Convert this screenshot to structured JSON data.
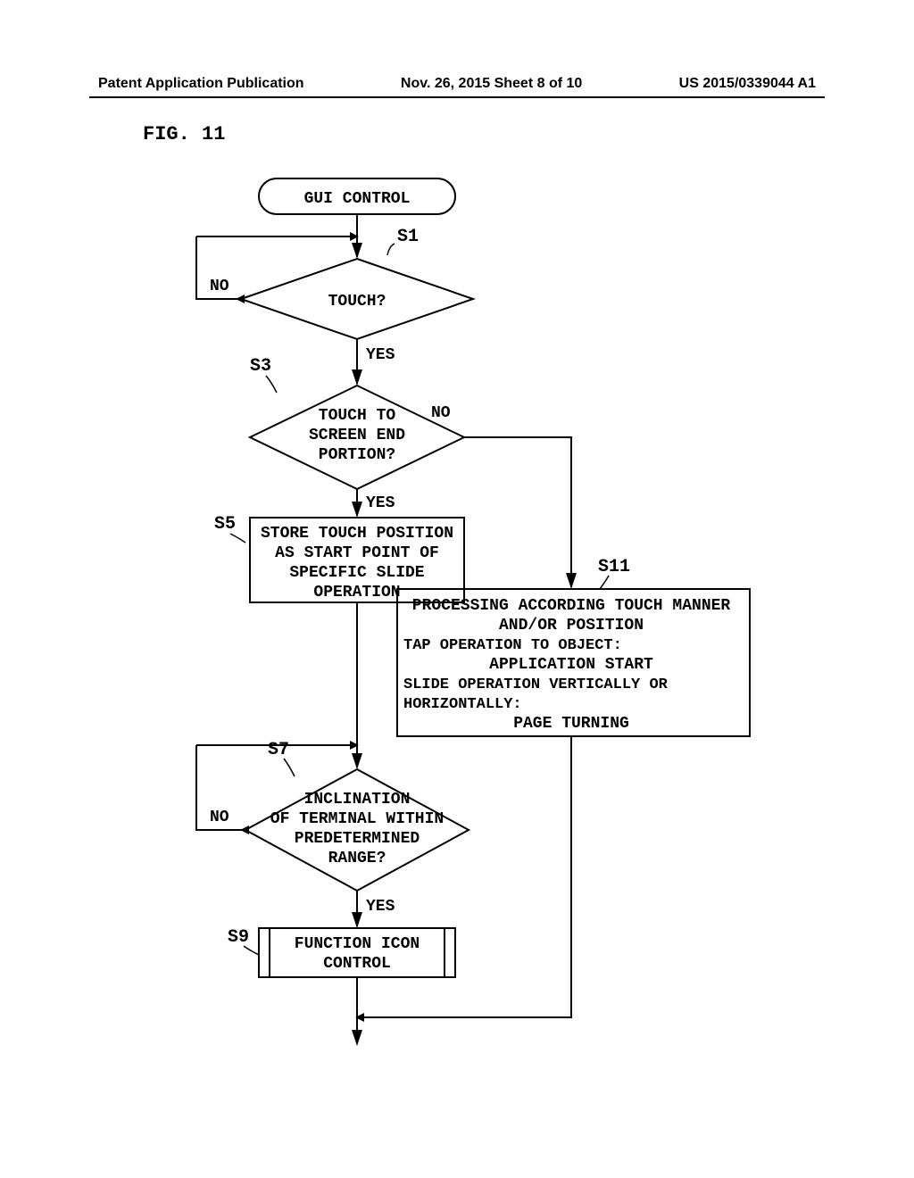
{
  "header": {
    "left": "Patent Application Publication",
    "center": "Nov. 26, 2015  Sheet 8 of 10",
    "right": "US 2015/0339044 A1"
  },
  "figure_label": "FIG. 11",
  "steps": {
    "s1": "S1",
    "s3": "S3",
    "s5": "S5",
    "s7": "S7",
    "s9": "S9",
    "s11": "S11"
  },
  "labels": {
    "yes": "YES",
    "no": "NO"
  },
  "nodes": {
    "start": "GUI CONTROL",
    "d1": "TOUCH?",
    "d2_l1": "TOUCH TO",
    "d2_l2": "SCREEN END",
    "d2_l3": "PORTION?",
    "p1_l1": "STORE TOUCH POSITION",
    "p1_l2": "AS START POINT OF",
    "p1_l3": "SPECIFIC SLIDE",
    "p1_l4": "OPERATION",
    "p2_l1": "PROCESSING ACCORDING TOUCH MANNER",
    "p2_l2": "AND/OR POSITION",
    "p2_l3": "TAP OPERATION TO OBJECT:",
    "p2_l4": "APPLICATION START",
    "p2_l5": "SLIDE OPERATION VERTICALLY OR",
    "p2_l6": "HORIZONTALLY:",
    "p2_l7": "PAGE TURNING",
    "d3_l1": "INCLINATION",
    "d3_l2": "OF TERMINAL WITHIN",
    "d3_l3": "PREDETERMINED",
    "d3_l4": "RANGE?",
    "p3_l1": "FUNCTION ICON",
    "p3_l2": "CONTROL"
  },
  "chart_data": {
    "type": "flowchart",
    "title": "GUI CONTROL",
    "nodes": [
      {
        "id": "start",
        "type": "terminator",
        "text": "GUI CONTROL"
      },
      {
        "id": "S1",
        "type": "decision",
        "text": "TOUCH?"
      },
      {
        "id": "S3",
        "type": "decision",
        "text": "TOUCH TO SCREEN END PORTION?"
      },
      {
        "id": "S5",
        "type": "process",
        "text": "STORE TOUCH POSITION AS START POINT OF SPECIFIC SLIDE OPERATION"
      },
      {
        "id": "S7",
        "type": "decision",
        "text": "INCLINATION OF TERMINAL WITHIN PREDETERMINED RANGE?"
      },
      {
        "id": "S9",
        "type": "subroutine",
        "text": "FUNCTION ICON CONTROL"
      },
      {
        "id": "S11",
        "type": "process",
        "text": "PROCESSING ACCORDING TOUCH MANNER AND/OR POSITION\nTAP OPERATION TO OBJECT: APPLICATION START\nSLIDE OPERATION VERTICALLY OR HORIZONTALLY: PAGE TURNING"
      }
    ],
    "edges": [
      {
        "from": "start",
        "to": "S1"
      },
      {
        "from": "S1",
        "to": "S1",
        "label": "NO",
        "loop": true
      },
      {
        "from": "S1",
        "to": "S3",
        "label": "YES"
      },
      {
        "from": "S3",
        "to": "S5",
        "label": "YES"
      },
      {
        "from": "S3",
        "to": "S11",
        "label": "NO"
      },
      {
        "from": "S5",
        "to": "S7"
      },
      {
        "from": "S7",
        "to": "S7",
        "label": "NO",
        "loop": true
      },
      {
        "from": "S7",
        "to": "S9",
        "label": "YES"
      },
      {
        "from": "S11",
        "to": "merge_after_S9"
      },
      {
        "from": "S9",
        "to": "end"
      }
    ]
  }
}
